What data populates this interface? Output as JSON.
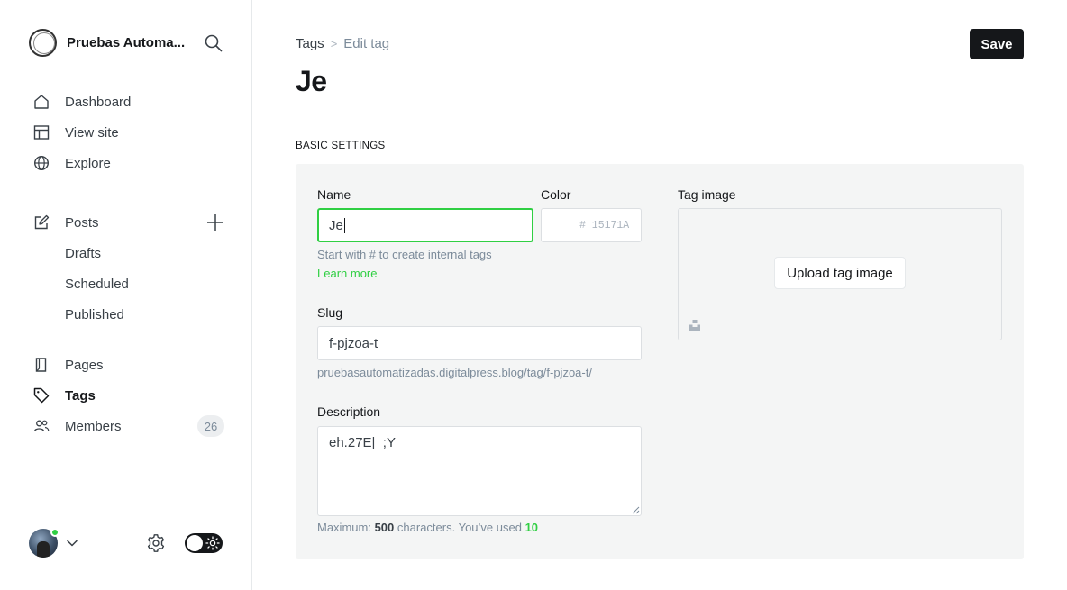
{
  "sidebar": {
    "site_name": "Pruebas Automa...",
    "nav": {
      "dashboard": "Dashboard",
      "view_site": "View site",
      "explore": "Explore",
      "posts": "Posts",
      "drafts": "Drafts",
      "scheduled": "Scheduled",
      "published": "Published",
      "pages": "Pages",
      "tags": "Tags",
      "members": "Members",
      "members_count": "26"
    },
    "active_item": "Tags",
    "online_status_color": "#30cf43"
  },
  "header": {
    "breadcrumb_parent": "Tags",
    "breadcrumb_separator": ">",
    "breadcrumb_current": "Edit tag",
    "title": "Je",
    "save_label": "Save"
  },
  "form": {
    "section_label": "BASIC SETTINGS",
    "name_label": "Name",
    "name_value": "Je",
    "name_hint": "Start with # to create internal tags",
    "learn_more": "Learn more",
    "color_label": "Color",
    "color_placeholder": "# 15171A",
    "slug_label": "Slug",
    "slug_value": "f-pjzoa-t",
    "slug_url": "pruebasautomatizadas.digitalpress.blog/tag/f-pjzoa-t/",
    "description_label": "Description",
    "description_value": "eh.27E|_;Y",
    "counter_prefix": "Maximum:",
    "counter_max": "500",
    "counter_middle": "characters. You’ve used",
    "counter_used": "10",
    "tag_image_label": "Tag image",
    "upload_label": "Upload tag image"
  },
  "colors": {
    "accent_green": "#30cf43",
    "primary_dark": "#15171a"
  }
}
